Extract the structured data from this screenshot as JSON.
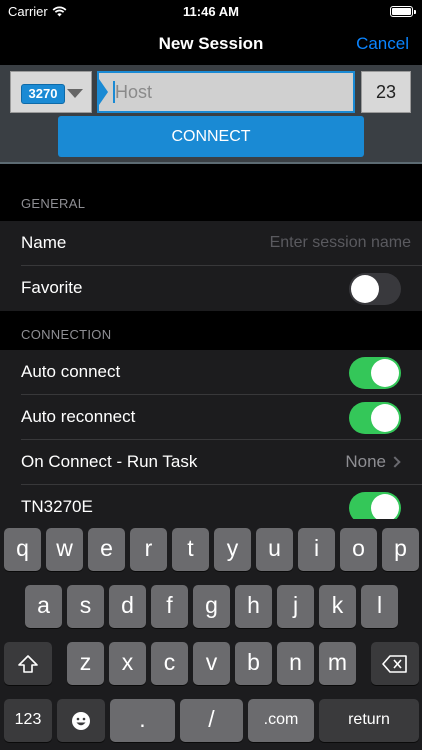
{
  "status_bar": {
    "carrier": "Carrier",
    "time": "11:46 AM"
  },
  "nav": {
    "title": "New Session",
    "cancel": "Cancel"
  },
  "connection": {
    "type": "3270",
    "host_placeholder": "Host",
    "port": "23",
    "connect_label": "CONNECT"
  },
  "sections": {
    "general": {
      "header": "GENERAL",
      "name_label": "Name",
      "name_placeholder": "Enter session name",
      "favorite_label": "Favorite",
      "favorite_on": false
    },
    "connection": {
      "header": "CONNECTION",
      "auto_connect_label": "Auto connect",
      "auto_connect_on": true,
      "auto_reconnect_label": "Auto reconnect",
      "auto_reconnect_on": true,
      "run_task_label": "On Connect - Run Task",
      "run_task_value": "None",
      "tn3270e_label": "TN3270E",
      "tn3270e_on": true
    }
  },
  "keyboard": {
    "row1": [
      "q",
      "w",
      "e",
      "r",
      "t",
      "y",
      "u",
      "i",
      "o",
      "p"
    ],
    "row2": [
      "a",
      "s",
      "d",
      "f",
      "g",
      "h",
      "j",
      "k",
      "l"
    ],
    "row3": [
      "z",
      "x",
      "c",
      "v",
      "b",
      "n",
      "m"
    ],
    "numbers": "123",
    "period": ".",
    "slash": "/",
    "dotcom": ".com",
    "return": "return",
    "icons": {
      "shift": "shift-icon",
      "delete": "delete-icon",
      "emoji": "emoji-icon",
      "wifi": "wifi-icon",
      "battery": "battery-icon"
    }
  },
  "colors": {
    "accent": "#1a8ad4",
    "ios_blue": "#0a84ff",
    "toggle_on": "#34c759"
  }
}
